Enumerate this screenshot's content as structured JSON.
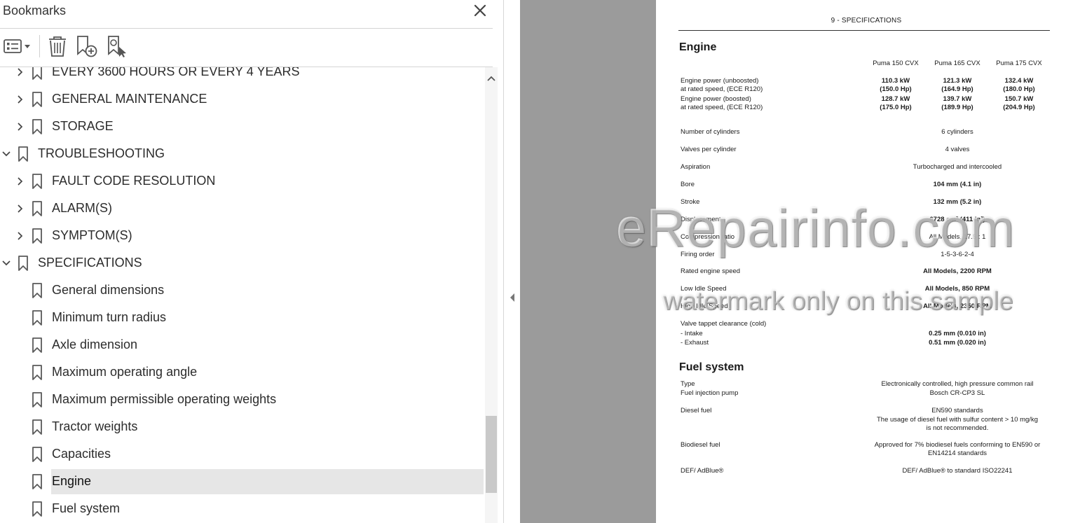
{
  "panel": {
    "title": "Bookmarks",
    "icons": {
      "close": "close-icon",
      "options": "bookmark-options-icon",
      "delete": "trash-icon",
      "new_bookmark": "new-bookmark-icon",
      "find_bookmark": "find-current-bookmark-icon"
    }
  },
  "tree": [
    {
      "label": "EVERY 3600 HOURS OR EVERY 4 YEARS",
      "level": 1,
      "expandable": true,
      "expanded": false
    },
    {
      "label": "GENERAL MAINTENANCE",
      "level": 1,
      "expandable": true,
      "expanded": false
    },
    {
      "label": "STORAGE",
      "level": 1,
      "expandable": true,
      "expanded": false
    },
    {
      "label": "TROUBLESHOOTING",
      "level": 0,
      "expandable": true,
      "expanded": true
    },
    {
      "label": "FAULT CODE RESOLUTION",
      "level": 1,
      "expandable": true,
      "expanded": false
    },
    {
      "label": "ALARM(S)",
      "level": 1,
      "expandable": true,
      "expanded": false
    },
    {
      "label": "SYMPTOM(S)",
      "level": 1,
      "expandable": true,
      "expanded": false
    },
    {
      "label": "SPECIFICATIONS",
      "level": 0,
      "expandable": true,
      "expanded": true
    },
    {
      "label": "General dimensions",
      "level": 1,
      "expandable": false
    },
    {
      "label": "Minimum turn radius",
      "level": 1,
      "expandable": false
    },
    {
      "label": "Axle dimension",
      "level": 1,
      "expandable": false
    },
    {
      "label": "Maximum operating angle",
      "level": 1,
      "expandable": false
    },
    {
      "label": "Maximum permissible operating weights",
      "level": 1,
      "expandable": false
    },
    {
      "label": "Tractor weights",
      "level": 1,
      "expandable": false
    },
    {
      "label": "Capacities",
      "level": 1,
      "expandable": false
    },
    {
      "label": "Engine",
      "level": 1,
      "expandable": false,
      "selected": true
    },
    {
      "label": "Fuel system",
      "level": 1,
      "expandable": false
    }
  ],
  "document": {
    "header": "9 - SPECIFICATIONS",
    "engine": {
      "title": "Engine",
      "models": [
        "Puma 150 CVX",
        "Puma 165 CVX",
        "Puma 175 CVX"
      ],
      "power_unboosted": {
        "label1": "Engine power (unboosted)",
        "label2": "at rated speed, (ECE R120)",
        "kw": [
          "110.3 kW",
          "121.3 kW",
          "132.4 kW"
        ],
        "hp": [
          "(150.0 Hp)",
          "(164.9 Hp)",
          "(180.0 Hp)"
        ]
      },
      "power_boosted": {
        "label1": "Engine power (boosted)",
        "label2": "at rated speed, (ECE R120)",
        "kw": [
          "128.7 kW",
          "139.7 kW",
          "150.7 kW"
        ],
        "hp": [
          "(175.0 Hp)",
          "(189.9 Hp)",
          "(204.9 Hp)"
        ]
      },
      "rows": [
        {
          "label": "Number of cylinders",
          "value": "6 cylinders",
          "bold": false
        },
        {
          "label": "Valves per cylinder",
          "value": "4 valves",
          "bold": false
        },
        {
          "label": "Aspiration",
          "value": "Turbocharged and intercooled",
          "bold": false
        },
        {
          "label": "Bore",
          "value": "104 mm (4.1 in)",
          "bold": true
        },
        {
          "label": "Stroke",
          "value": "132 mm (5.2 in)",
          "bold": true
        },
        {
          "label": "Displacement",
          "value": "6728 cm³ (411 in³)",
          "bold": true
        },
        {
          "label": "Compression ratio",
          "value": "All Models, 17.5 : 1",
          "bold": false
        },
        {
          "label": "Firing order",
          "value": "1-5-3-6-2-4",
          "bold": false
        },
        {
          "label": "Rated engine speed",
          "value": "All Models, 2200 RPM",
          "bold": true
        },
        {
          "label": "Low Idle Speed",
          "value": "All Models, 850 RPM",
          "bold": true
        },
        {
          "label": "High Idle Speed",
          "value": "All Models, 2350 RPM",
          "bold": true
        }
      ],
      "valve_clearance": {
        "label": "Valve tappet clearance (cold)",
        "intake_label": "- Intake",
        "intake_value": "0.25 mm (0.010 in)",
        "exhaust_label": "- Exhaust",
        "exhaust_value": "0.51 mm (0.020 in)"
      }
    },
    "fuel": {
      "title": "Fuel system",
      "type_label": "Type",
      "type_value": "Electronically controlled, high pressure common rail",
      "pump_label": "Fuel injection pump",
      "pump_value": "Bosch CR-CP3 SL",
      "diesel_label": "Diesel fuel",
      "diesel_values": [
        "EN590 standards",
        "The usage of diesel fuel with sulfur content > 10 mg/kg",
        "is not recommended."
      ],
      "biodiesel_label": "Biodiesel fuel",
      "biodiesel_values": [
        "Approved for 7% biodiesel fuels conforming to EN590 or",
        "EN14214 standards"
      ],
      "def_label": "DEF/ AdBlue®",
      "def_value": "DEF/ AdBlue® to standard ISO22241"
    }
  },
  "watermark": {
    "line1": "eRepairinfo.com",
    "line2": "watermark only on this sample"
  }
}
